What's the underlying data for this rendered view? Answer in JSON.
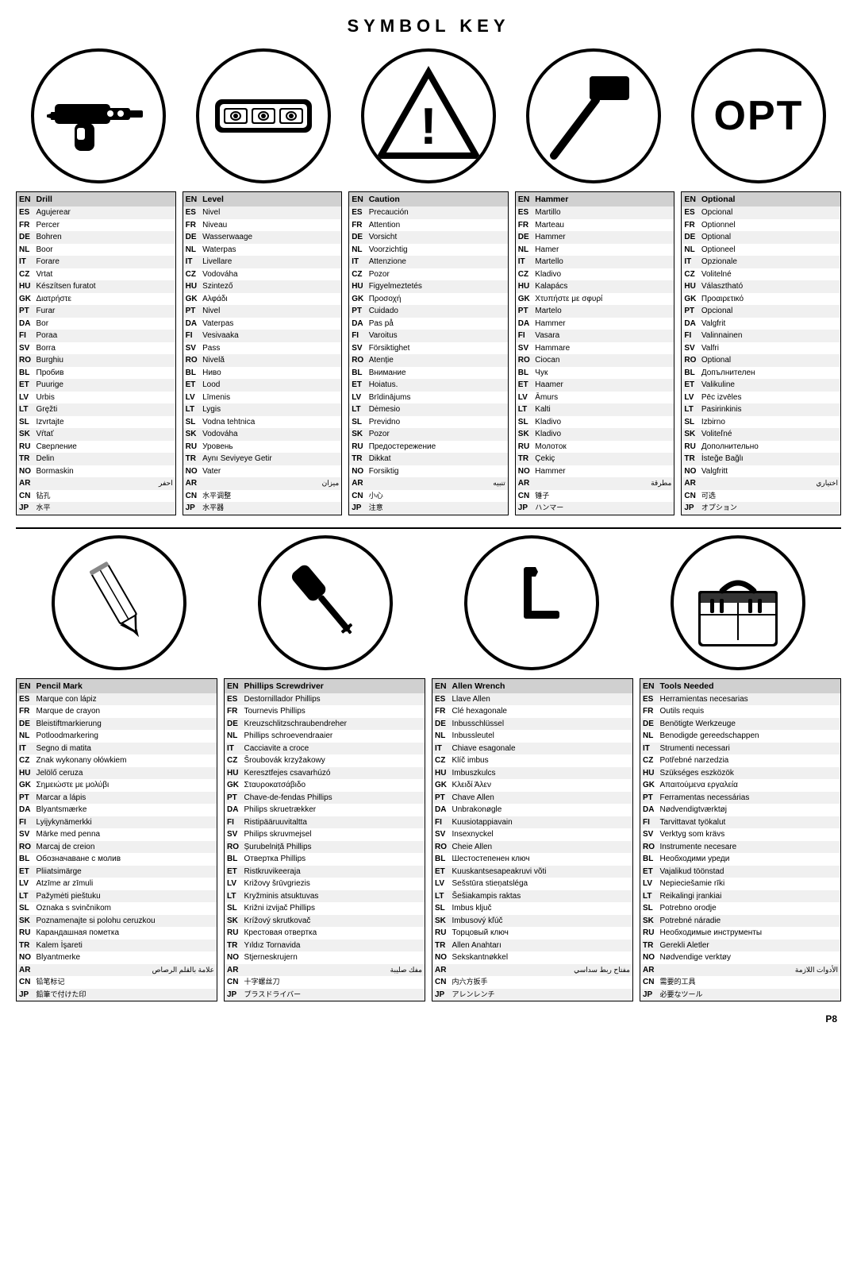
{
  "title": "SYMBOL KEY",
  "icons": [
    {
      "id": "drill",
      "label": "drill-icon"
    },
    {
      "id": "level",
      "label": "level-icon"
    },
    {
      "id": "caution",
      "label": "caution-icon"
    },
    {
      "id": "hammer",
      "label": "hammer-icon"
    },
    {
      "id": "optional",
      "label": "optional-icon"
    }
  ],
  "tables_top": [
    {
      "id": "drill",
      "header": [
        "EN",
        "Drill"
      ],
      "rows": [
        [
          "ES",
          "Agujerear"
        ],
        [
          "FR",
          "Percer"
        ],
        [
          "DE",
          "Bohren"
        ],
        [
          "NL",
          "Boor"
        ],
        [
          "IT",
          "Forare"
        ],
        [
          "CZ",
          "Vrtat"
        ],
        [
          "HU",
          "Készítsen furatot"
        ],
        [
          "GK",
          "Διατρήστε"
        ],
        [
          "PT",
          "Furar"
        ],
        [
          "DA",
          "Bor"
        ],
        [
          "FI",
          "Poraa"
        ],
        [
          "SV",
          "Borra"
        ],
        [
          "RO",
          "Burghiu"
        ],
        [
          "BL",
          "Пробив"
        ],
        [
          "ET",
          "Puurige"
        ],
        [
          "LV",
          "Urbis"
        ],
        [
          "LT",
          "Gręžti"
        ],
        [
          "SL",
          "Izvrtajte"
        ],
        [
          "SK",
          "Vŕtať"
        ],
        [
          "RU",
          "Сверление"
        ],
        [
          "TR",
          "Delin"
        ],
        [
          "NO",
          "Bormaskin"
        ],
        [
          "AR",
          "احفر"
        ],
        [
          "CN",
          "钻孔"
        ],
        [
          "JP",
          "水平"
        ]
      ]
    },
    {
      "id": "level",
      "header": [
        "EN",
        "Level"
      ],
      "rows": [
        [
          "ES",
          "Nivel"
        ],
        [
          "FR",
          "Niveau"
        ],
        [
          "DE",
          "Wasserwaage"
        ],
        [
          "NL",
          "Waterpas"
        ],
        [
          "IT",
          "Livellare"
        ],
        [
          "CZ",
          "Vodováha"
        ],
        [
          "HU",
          "Szintező"
        ],
        [
          "GK",
          "Αλφάδι"
        ],
        [
          "PT",
          "Nivel"
        ],
        [
          "DA",
          "Vaterpas"
        ],
        [
          "FI",
          "Vesivaaka"
        ],
        [
          "SV",
          "Pass"
        ],
        [
          "RO",
          "Nivelă"
        ],
        [
          "BL",
          "Ниво"
        ],
        [
          "ET",
          "Lood"
        ],
        [
          "LV",
          "Līmenis"
        ],
        [
          "LT",
          "Lygis"
        ],
        [
          "SL",
          "Vodna tehtnica"
        ],
        [
          "SK",
          "Vodováha"
        ],
        [
          "RU",
          "Уровень"
        ],
        [
          "TR",
          "Aynı Seviyeye Getir"
        ],
        [
          "NO",
          "Vater"
        ],
        [
          "AR",
          "ميزان"
        ],
        [
          "CN",
          "水平调整"
        ],
        [
          "JP",
          "水平器"
        ]
      ]
    },
    {
      "id": "caution",
      "header": [
        "EN",
        "Caution"
      ],
      "rows": [
        [
          "ES",
          "Precaución"
        ],
        [
          "FR",
          "Attention"
        ],
        [
          "DE",
          "Vorsicht"
        ],
        [
          "NL",
          "Voorzichtig"
        ],
        [
          "IT",
          "Attenzione"
        ],
        [
          "CZ",
          "Pozor"
        ],
        [
          "HU",
          "Figyelmeztetés"
        ],
        [
          "GK",
          "Προσοχή"
        ],
        [
          "PT",
          "Cuidado"
        ],
        [
          "DA",
          "Pas på"
        ],
        [
          "FI",
          "Varoitus"
        ],
        [
          "SV",
          "Försiktighet"
        ],
        [
          "RO",
          "Atenție"
        ],
        [
          "BL",
          "Внимание"
        ],
        [
          "ET",
          "Hoiatus."
        ],
        [
          "LV",
          "Brīdinājums"
        ],
        [
          "LT",
          "Dėmesio"
        ],
        [
          "SL",
          "Previdno"
        ],
        [
          "SK",
          "Pozor"
        ],
        [
          "RU",
          "Предостережение"
        ],
        [
          "TR",
          "Dikkat"
        ],
        [
          "NO",
          "Forsiktig"
        ],
        [
          "AR",
          "تنبيه"
        ],
        [
          "CN",
          "小心"
        ],
        [
          "JP",
          "注意"
        ]
      ]
    },
    {
      "id": "hammer",
      "header": [
        "EN",
        "Hammer"
      ],
      "rows": [
        [
          "ES",
          "Martillo"
        ],
        [
          "FR",
          "Marteau"
        ],
        [
          "DE",
          "Hammer"
        ],
        [
          "NL",
          "Hamer"
        ],
        [
          "IT",
          "Martello"
        ],
        [
          "CZ",
          "Kladivo"
        ],
        [
          "HU",
          "Kalapács"
        ],
        [
          "GK",
          "Χτυπήστε με σφυρί"
        ],
        [
          "PT",
          "Martelo"
        ],
        [
          "DA",
          "Hammer"
        ],
        [
          "FI",
          "Vasara"
        ],
        [
          "SV",
          "Hammare"
        ],
        [
          "RO",
          "Ciocan"
        ],
        [
          "BL",
          "Чук"
        ],
        [
          "ET",
          "Haamer"
        ],
        [
          "LV",
          "Āmurs"
        ],
        [
          "LT",
          "Kalti"
        ],
        [
          "SL",
          "Kladivo"
        ],
        [
          "SK",
          "Kladivo"
        ],
        [
          "RU",
          "Молоток"
        ],
        [
          "TR",
          "Çekiç"
        ],
        [
          "NO",
          "Hammer"
        ],
        [
          "AR",
          "مطرقة"
        ],
        [
          "CN",
          "锤子"
        ],
        [
          "JP",
          "ハンマー"
        ]
      ]
    },
    {
      "id": "optional",
      "header": [
        "EN",
        "Optional"
      ],
      "rows": [
        [
          "ES",
          "Opcional"
        ],
        [
          "FR",
          "Optionnel"
        ],
        [
          "DE",
          "Optional"
        ],
        [
          "NL",
          "Optioneel"
        ],
        [
          "IT",
          "Opzionale"
        ],
        [
          "CZ",
          "Volitelné"
        ],
        [
          "HU",
          "Választható"
        ],
        [
          "GK",
          "Προαιρετικό"
        ],
        [
          "PT",
          "Opcional"
        ],
        [
          "DA",
          "Valgfrit"
        ],
        [
          "FI",
          "Valinnainen"
        ],
        [
          "SV",
          "Valfri"
        ],
        [
          "RO",
          "Optional"
        ],
        [
          "BL",
          "Допълнителен"
        ],
        [
          "ET",
          "Valikuline"
        ],
        [
          "LV",
          "Pēc izvēles"
        ],
        [
          "LT",
          "Pasirinkinis"
        ],
        [
          "SL",
          "Izbirno"
        ],
        [
          "SK",
          "Voliteľné"
        ],
        [
          "RU",
          "Дополнительно"
        ],
        [
          "TR",
          "İsteğe Bağlı"
        ],
        [
          "NO",
          "Valgfritt"
        ],
        [
          "AR",
          "اختياري"
        ],
        [
          "CN",
          "可选"
        ],
        [
          "JP",
          "オプション"
        ]
      ]
    }
  ],
  "icons_bottom": [
    {
      "id": "pencil",
      "label": "pencil-icon"
    },
    {
      "id": "phillips",
      "label": "phillips-screwdriver-icon"
    },
    {
      "id": "allen",
      "label": "allen-wrench-icon"
    },
    {
      "id": "toolbox",
      "label": "toolbox-icon"
    }
  ],
  "tables_bottom": [
    {
      "id": "pencil",
      "header": [
        "EN",
        "Pencil Mark"
      ],
      "rows": [
        [
          "ES",
          "Marque con lápiz"
        ],
        [
          "FR",
          "Marque de crayon"
        ],
        [
          "DE",
          "Bleistiftmarkierung"
        ],
        [
          "NL",
          "Potloodmarkering"
        ],
        [
          "IT",
          "Segno di matita"
        ],
        [
          "CZ",
          "Znak wykonany ołówkiem"
        ],
        [
          "HU",
          "Jelölő ceruza"
        ],
        [
          "GK",
          "Σημειώστε με μολύβι"
        ],
        [
          "PT",
          "Marcar a lápis"
        ],
        [
          "DA",
          "Blyantsmærke"
        ],
        [
          "FI",
          "Lyijykynämerkki"
        ],
        [
          "SV",
          "Märke med penna"
        ],
        [
          "RO",
          "Marcaj de creion"
        ],
        [
          "BL",
          "Обозначаване с молив"
        ],
        [
          "ET",
          "Pliiatsimärge"
        ],
        [
          "LV",
          "Atzīme ar zīmuli"
        ],
        [
          "LT",
          "Pažymėti pieštuku"
        ],
        [
          "SL",
          "Oznaka s svinčnikom"
        ],
        [
          "SK",
          "Poznamenajte si polohu ceruzkou"
        ],
        [
          "RU",
          "Карандашная пометка"
        ],
        [
          "TR",
          "Kalem İşareti"
        ],
        [
          "NO",
          "Blyantmerke"
        ],
        [
          "AR",
          "علامة بالقلم الرصاص"
        ],
        [
          "CN",
          "铅笔标记"
        ],
        [
          "JP",
          "鉛筆で付けた印"
        ]
      ]
    },
    {
      "id": "phillips",
      "header": [
        "EN",
        "Phillips Screwdriver"
      ],
      "rows": [
        [
          "ES",
          "Destornillador Phillips"
        ],
        [
          "FR",
          "Tournevis Phillips"
        ],
        [
          "DE",
          "Kreuzschlitzschraubendreher"
        ],
        [
          "NL",
          "Phillips schroevendraaier"
        ],
        [
          "IT",
          "Cacciavite a croce"
        ],
        [
          "CZ",
          "Šroubovák krzyžakowy"
        ],
        [
          "HU",
          "Keresztfejes csavarhúzó"
        ],
        [
          "GK",
          "Σταυροκατσάβιδο"
        ],
        [
          "PT",
          "Chave-de-fendas Phillips"
        ],
        [
          "DA",
          "Philips skruetrækker"
        ],
        [
          "FI",
          "Ristipääruuvitaltta"
        ],
        [
          "SV",
          "Philips skruvmejsel"
        ],
        [
          "RO",
          "Șurubelniță Phillips"
        ],
        [
          "BL",
          "Отвертка Phillips"
        ],
        [
          "ET",
          "Ristkruvikeeraja"
        ],
        [
          "LV",
          "Križovy šrūvgriezis"
        ],
        [
          "LT",
          "Kryžminis atsuktuvas"
        ],
        [
          "SL",
          "Križni izvijač Phillips"
        ],
        [
          "SK",
          "Krížový skrutkovač"
        ],
        [
          "RU",
          "Крестовая отвертка"
        ],
        [
          "TR",
          "Yıldız Tornavida"
        ],
        [
          "NO",
          "Stjerneskrujern"
        ],
        [
          "AR",
          "مفك صليبة"
        ],
        [
          "CN",
          "十字螺丝刀"
        ],
        [
          "JP",
          "プラスドライバー"
        ]
      ]
    },
    {
      "id": "allen",
      "header": [
        "EN",
        "Allen Wrench"
      ],
      "rows": [
        [
          "ES",
          "Llave Allen"
        ],
        [
          "FR",
          "Clé hexagonale"
        ],
        [
          "DE",
          "Inbusschlüssel"
        ],
        [
          "NL",
          "Inbussleutel"
        ],
        [
          "IT",
          "Chiave esagonale"
        ],
        [
          "CZ",
          "Klíč imbus"
        ],
        [
          "HU",
          "Imbuszkulcs"
        ],
        [
          "GK",
          "Κλειδί Άλεν"
        ],
        [
          "PT",
          "Chave Allen"
        ],
        [
          "DA",
          "Unbrakonøgle"
        ],
        [
          "FI",
          "Kuusiotappiavain"
        ],
        [
          "SV",
          "Insexnyckel"
        ],
        [
          "RO",
          "Cheie Allen"
        ],
        [
          "BL",
          "Шестостепенен ключ"
        ],
        [
          "ET",
          "Kuuskantsesapeakruvi võti"
        ],
        [
          "LV",
          "Sešstūra stieņatsléga"
        ],
        [
          "LT",
          "Šešiakampis raktas"
        ],
        [
          "SL",
          "Imbus ključ"
        ],
        [
          "SK",
          "Imbusový kľúč"
        ],
        [
          "RU",
          "Торцовый ключ"
        ],
        [
          "TR",
          "Allen Anahtarı"
        ],
        [
          "NO",
          "Sekskantnøkkel"
        ],
        [
          "AR",
          "مفتاح ربط سداسي"
        ],
        [
          "CN",
          "内六方扳手"
        ],
        [
          "JP",
          "アレンレンチ"
        ]
      ]
    },
    {
      "id": "toolbox",
      "header": [
        "EN",
        "Tools Needed"
      ],
      "rows": [
        [
          "ES",
          "Herramientas necesarias"
        ],
        [
          "FR",
          "Outils requis"
        ],
        [
          "DE",
          "Benötigte Werkzeuge"
        ],
        [
          "NL",
          "Benodigde gereedschappen"
        ],
        [
          "IT",
          "Strumenti necessari"
        ],
        [
          "CZ",
          "Potřebné narzedzia"
        ],
        [
          "HU",
          "Szükséges eszközök"
        ],
        [
          "GK",
          "Απαιτούμενα εργαλεία"
        ],
        [
          "PT",
          "Ferramentas necessárias"
        ],
        [
          "DA",
          "Nødvendigtværktøj"
        ],
        [
          "FI",
          "Tarvittavat työkalut"
        ],
        [
          "SV",
          "Verktyg som krävs"
        ],
        [
          "RO",
          "Instrumente necesare"
        ],
        [
          "BL",
          "Необходими уреди"
        ],
        [
          "ET",
          "Vajalikud töönstad"
        ],
        [
          "LV",
          "Nepieciešamie rīki"
        ],
        [
          "LT",
          "Reikalingi įrankiai"
        ],
        [
          "SL",
          "Potrebno orodje"
        ],
        [
          "SK",
          "Potrebné náradie"
        ],
        [
          "RU",
          "Необходимые инструменты"
        ],
        [
          "TR",
          "Gerekli Aletler"
        ],
        [
          "NO",
          "Nødvendige verktøy"
        ],
        [
          "AR",
          "الأدوات اللازمة"
        ],
        [
          "CN",
          "需要的工具"
        ],
        [
          "JP",
          "必要なツール"
        ]
      ]
    }
  ],
  "page_number": "P8"
}
